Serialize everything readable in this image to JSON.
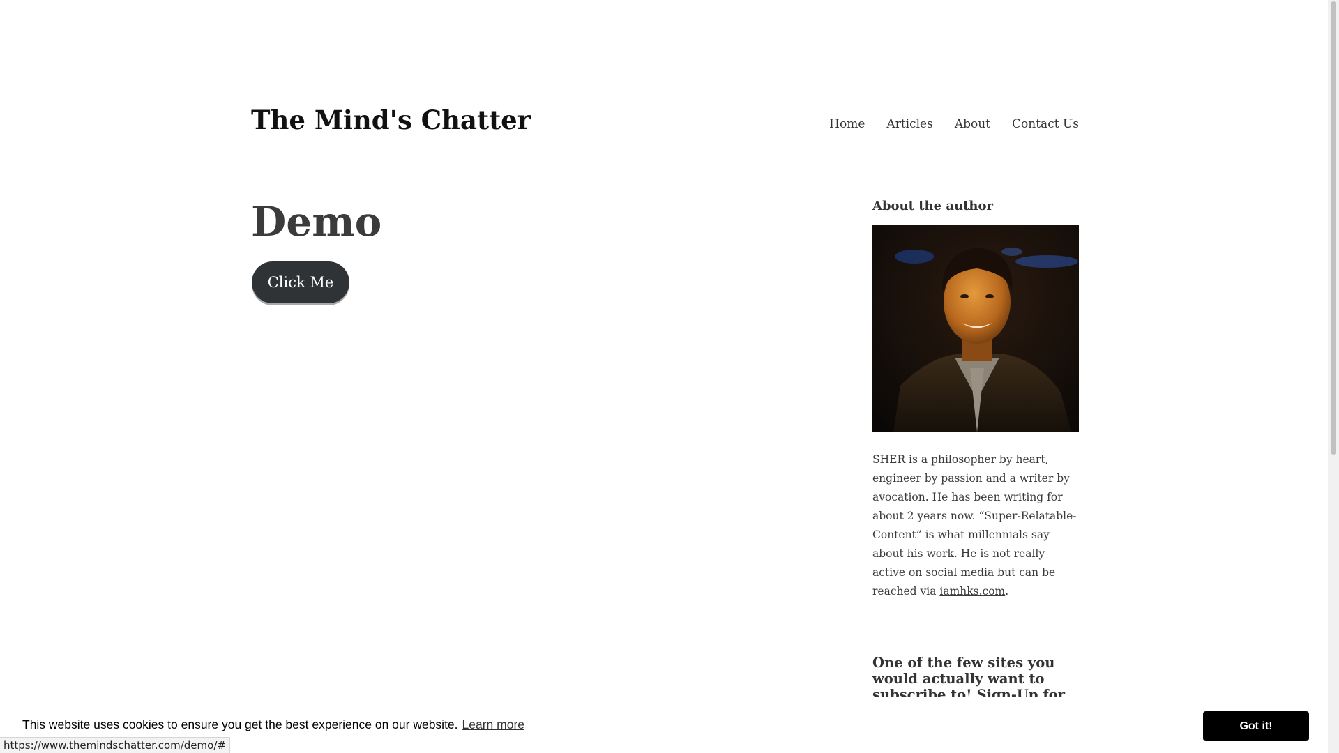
{
  "header": {
    "site_title": "The Mind's Chatter",
    "nav": [
      "Home",
      "Articles",
      "About",
      "Contact Us"
    ]
  },
  "main": {
    "heading": "Demo",
    "button_label": "Click Me"
  },
  "sidebar": {
    "about_title": "About the author",
    "bio_text": "SHER is a philosopher by heart, engineer by passion and a writer by avocation. He has been writing for about 2 years now. “Super-Relatable-Content” is what millennials say about his work. He is not really active on social media but can be reached via ",
    "bio_link": "iamhks.com",
    "bio_end": ".",
    "subscribe_title": "One of the few sites you would actually want to subscribe to! Sign-Up for more content:"
  },
  "cookie_bar": {
    "message": "This website uses cookies to ensure you get the best experience on our website.",
    "learn_more": "Learn more",
    "accept_label": "Got it!"
  },
  "status_bar": {
    "url": "https://www.themindschatter.com/demo/#"
  }
}
